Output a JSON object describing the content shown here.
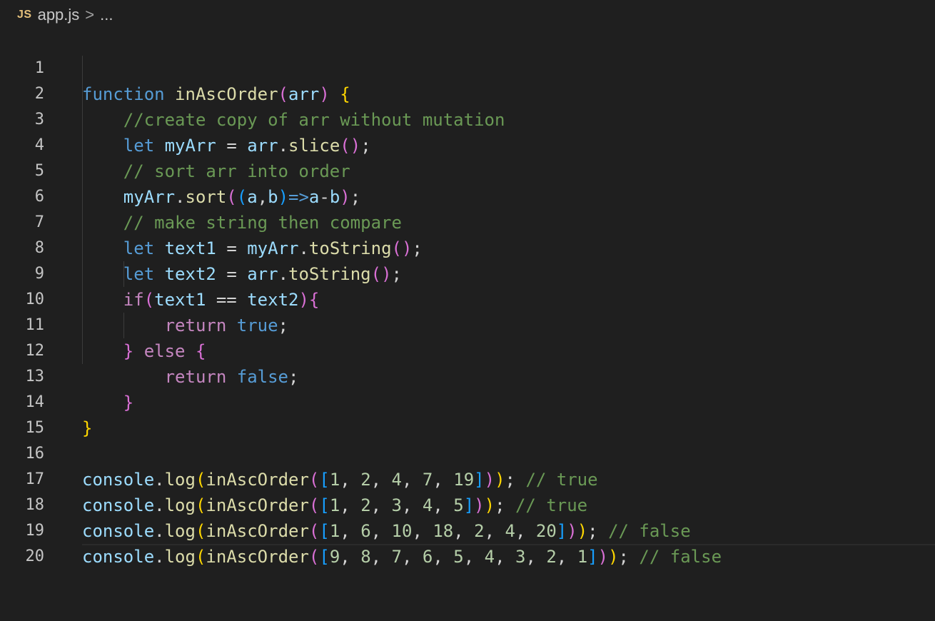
{
  "breadcrumb": {
    "lang_badge": "JS",
    "file": "app.js",
    "separator": ">",
    "trail": "..."
  },
  "line_numbers": [
    "1",
    "2",
    "3",
    "4",
    "5",
    "6",
    "7",
    "8",
    "9",
    "10",
    "11",
    "12",
    "13",
    "14",
    "15",
    "16",
    "17",
    "18",
    "19",
    "20"
  ],
  "code": {
    "l1": {
      "kw": "function",
      "name": "inAscOrder",
      "open": "(",
      "param": "arr",
      "close": ")",
      "brace": "{"
    },
    "l2": {
      "comment": "//create copy of arr without mutation"
    },
    "l3": {
      "kw": "let",
      "var": "myArr",
      "eq": "=",
      "obj": "arr",
      "dot": ".",
      "method": "slice",
      "parens": "()",
      "semi": ";"
    },
    "l4": {
      "comment": "// sort arr into order"
    },
    "l5": {
      "obj": "myArr",
      "dot": ".",
      "method": "sort",
      "p1": "(",
      "p2": "(",
      "a": "a",
      "comma": ",",
      "b": "b",
      "p3": ")",
      "arrow": "=>",
      "a2": "a",
      "minus": "-",
      "b2": "b",
      "p4": ")",
      "semi": ";"
    },
    "l6": {
      "comment": "// make string then compare"
    },
    "l7": {
      "kw": "let",
      "var": "text1",
      "eq": "=",
      "obj": "myArr",
      "dot": ".",
      "method": "toString",
      "parens": "()",
      "semi": ";"
    },
    "l8": {
      "kw": "let",
      "var": "text2",
      "eq": "=",
      "obj": "arr",
      "dot": ".",
      "method": "toString",
      "parens": "()",
      "semi": ";"
    },
    "l9": {
      "kw": "if",
      "open": "(",
      "a": "text1",
      "op": "==",
      "b": "text2",
      "close": ")",
      "brace": "{"
    },
    "l10": {
      "kw": "return",
      "val": "true",
      "semi": ";"
    },
    "l11": {
      "close": "}",
      "kw": "else",
      "open": "{"
    },
    "l12": {
      "kw": "return",
      "val": "false",
      "semi": ";"
    },
    "l13": {
      "close": "}"
    },
    "l14": {
      "close": "}"
    },
    "l16": {
      "obj": "console",
      "dot": ".",
      "method": "log",
      "p1": "(",
      "fn": "inAscOrder",
      "p2": "(",
      "b1": "[",
      "nums": [
        "1",
        "2",
        "4",
        "7",
        "19"
      ],
      "b2": "]",
      "p3": ")",
      "p4": ")",
      "semi": ";",
      "comment": "// true"
    },
    "l17": {
      "obj": "console",
      "dot": ".",
      "method": "log",
      "p1": "(",
      "fn": "inAscOrder",
      "p2": "(",
      "b1": "[",
      "nums": [
        "1",
        "2",
        "3",
        "4",
        "5"
      ],
      "b2": "]",
      "p3": ")",
      "p4": ")",
      "semi": ";",
      "comment": "// true"
    },
    "l18": {
      "obj": "console",
      "dot": ".",
      "method": "log",
      "p1": "(",
      "fn": "inAscOrder",
      "p2": "(",
      "b1": "[",
      "nums": [
        "1",
        "6",
        "10",
        "18",
        "2",
        "4",
        "20"
      ],
      "b2": "]",
      "p3": ")",
      "p4": ")",
      "semi": ";",
      "comment": "// false"
    },
    "l19": {
      "obj": "console",
      "dot": ".",
      "method": "log",
      "p1": "(",
      "fn": "inAscOrder",
      "p2": "(",
      "b1": "[",
      "nums": [
        "9",
        "8",
        "7",
        "6",
        "5",
        "4",
        "3",
        "2",
        "1"
      ],
      "b2": "]",
      "p3": ")",
      "p4": ")",
      "semi": ";",
      "comment": "// false"
    }
  },
  "colors": {
    "background": "#1f1f1f",
    "keyword": "#569cd6",
    "control_keyword": "#c586c0",
    "function": "#dcdcaa",
    "variable": "#9cdcfe",
    "comment": "#6a9955",
    "number": "#b5cea8",
    "bracket_1": "#ffd700",
    "bracket_2": "#da70d6",
    "bracket_3": "#179fff"
  }
}
